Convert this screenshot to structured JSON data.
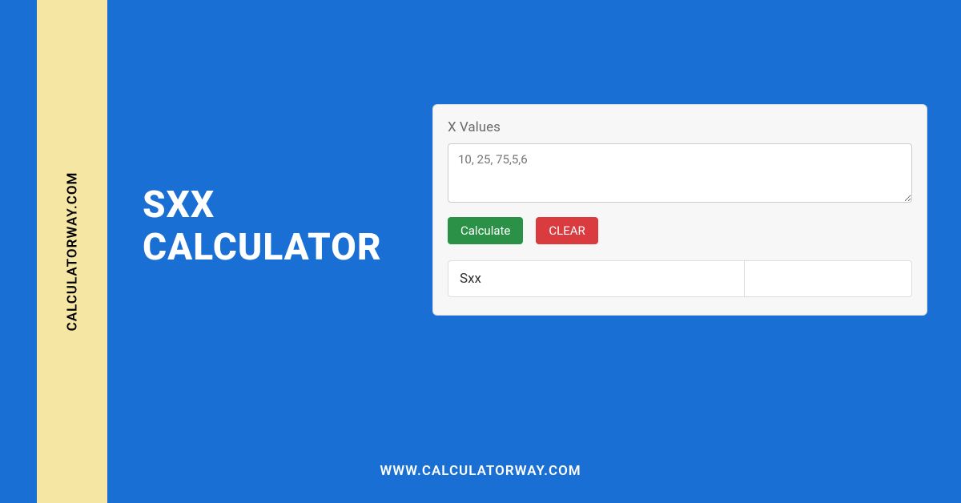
{
  "brand": {
    "vertical_label": "CALCULATORWAY.COM",
    "footer_label": "WWW.CALCULATORWAY.COM"
  },
  "title": {
    "line1": "SXX",
    "line2": "CALCULATOR"
  },
  "calculator": {
    "x_label": "X Values",
    "x_placeholder": "10, 25, 75,5,6",
    "calculate_label": "Calculate",
    "clear_label": "CLEAR",
    "result_label": "Sxx",
    "result_value": ""
  }
}
